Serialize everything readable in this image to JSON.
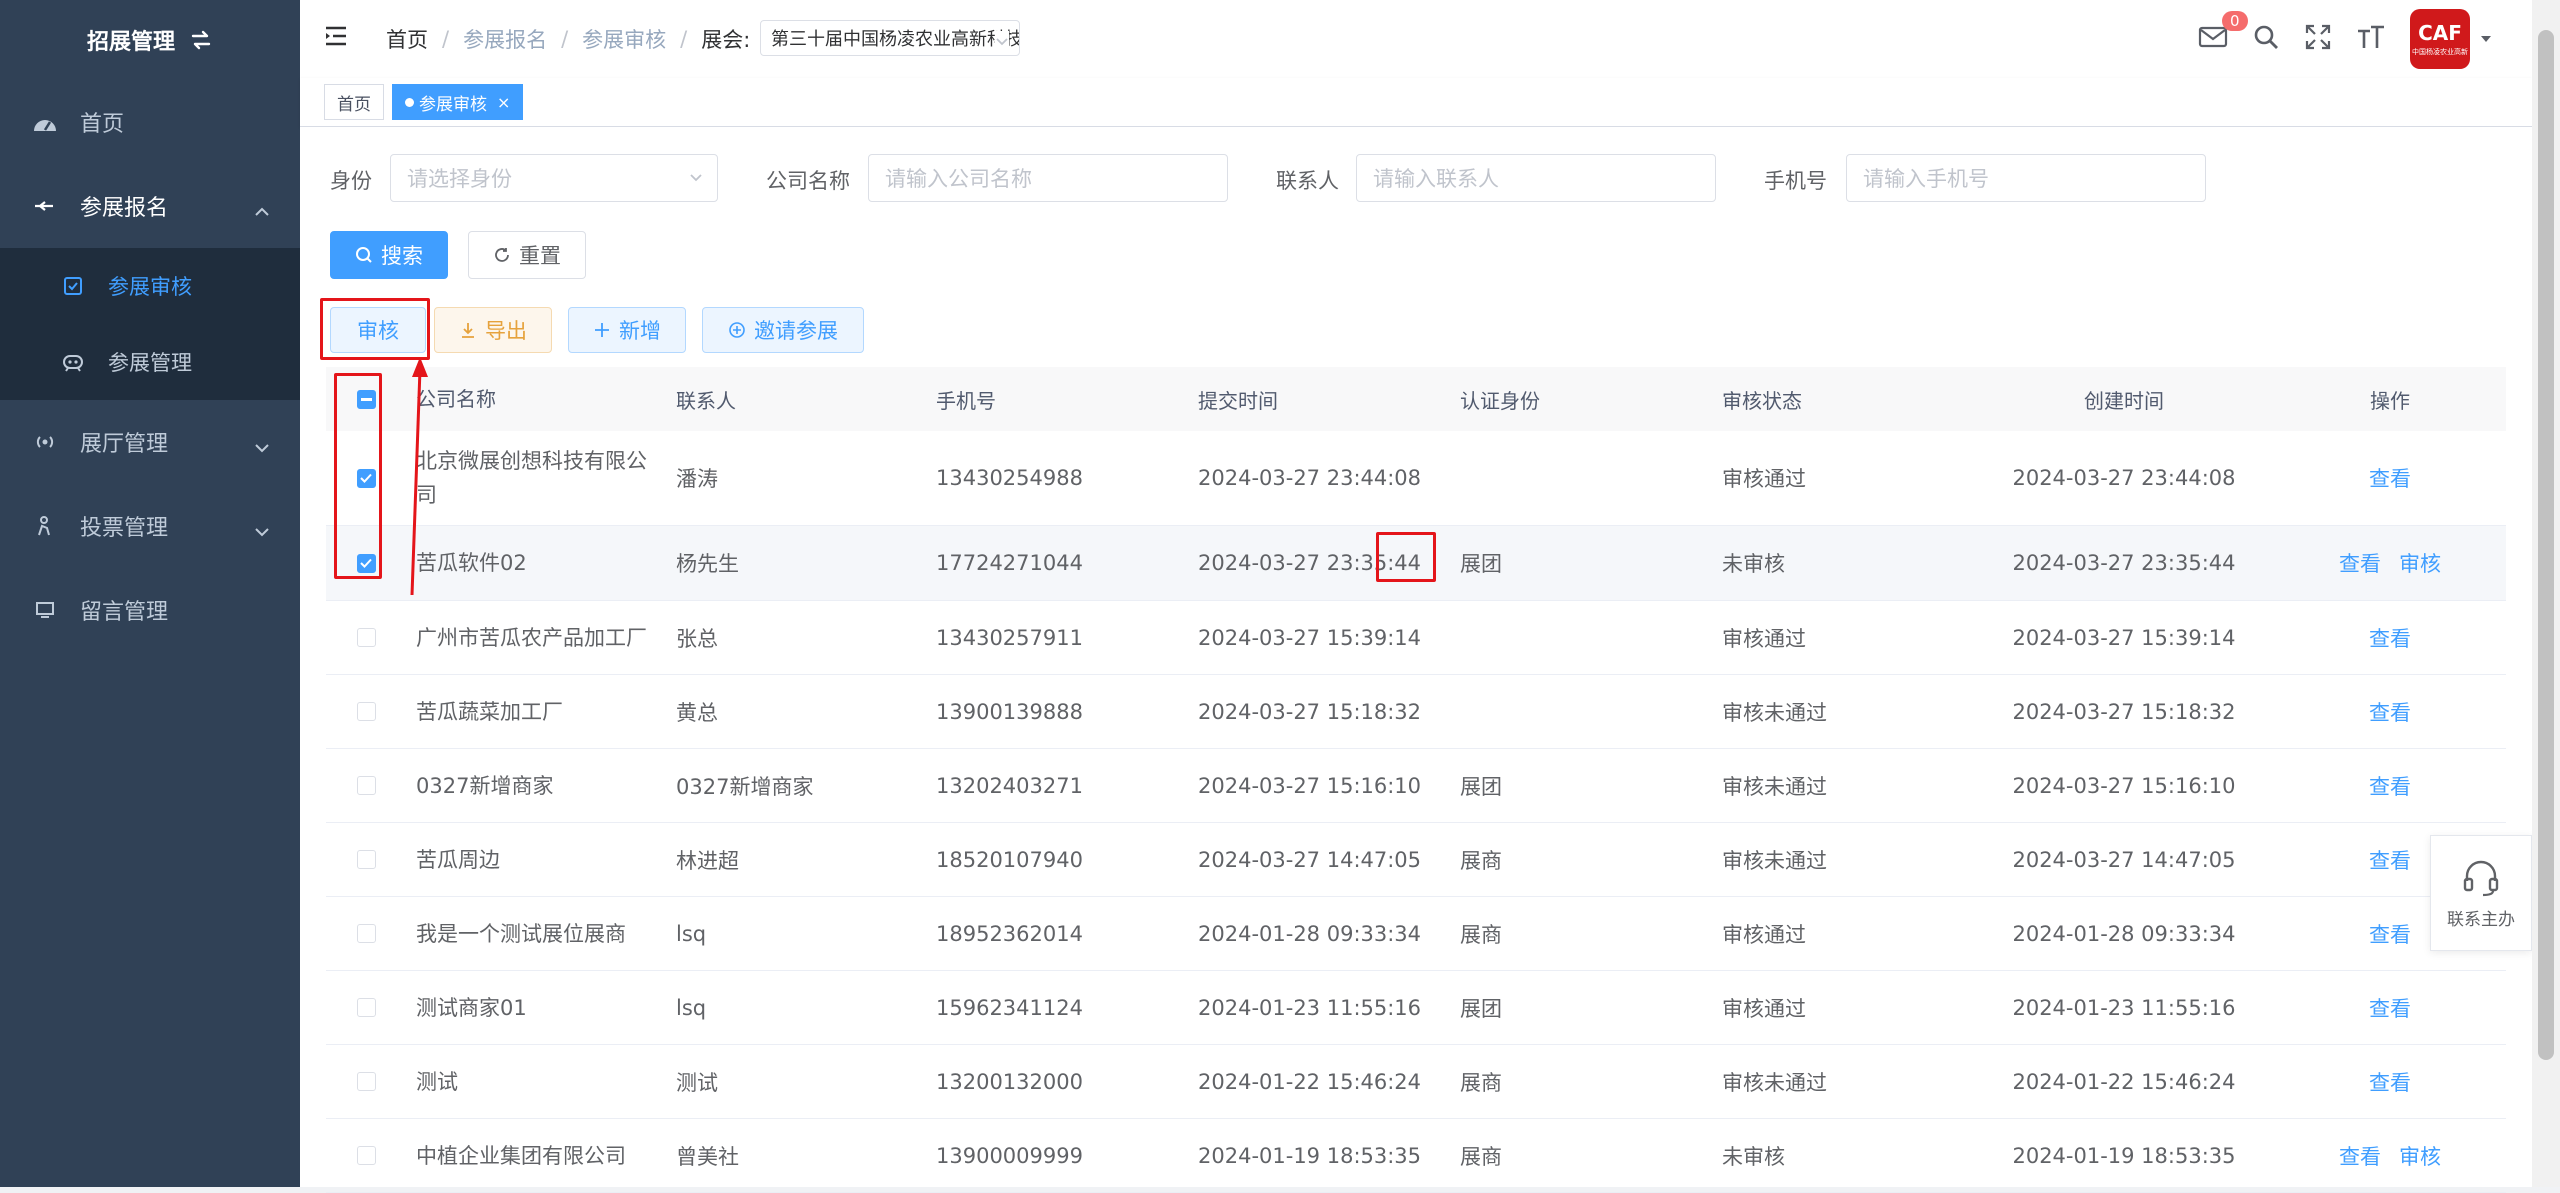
{
  "sidebar": {
    "title": "招展管理",
    "items": [
      {
        "label": "首页",
        "icon": "dashboard-icon"
      },
      {
        "label": "参展报名",
        "icon": "arrow-icon"
      },
      {
        "label": "展厅管理",
        "icon": "broadcast-icon"
      },
      {
        "label": "投票管理",
        "icon": "vote-icon"
      },
      {
        "label": "留言管理",
        "icon": "monitor-icon"
      }
    ],
    "sub_items": [
      {
        "label": "参展审核",
        "icon": "checkbox-icon"
      },
      {
        "label": "参展管理",
        "icon": "robot-icon"
      }
    ]
  },
  "header": {
    "breadcrumb": [
      "首页",
      "参展报名",
      "参展审核"
    ],
    "expo_label": "展会:",
    "expo_value": "第三十届中国杨凌农业高新科技成果博览会",
    "message_count": "0",
    "avatar_text": "CAF",
    "avatar_subtext": "中国杨凌农业高新"
  },
  "tags": {
    "home": "首页",
    "active": "参展审核"
  },
  "search": {
    "identity_label": "身份",
    "identity_placeholder": "请选择身份",
    "company_label": "公司名称",
    "company_placeholder": "请输入公司名称",
    "contact_label": "联系人",
    "contact_placeholder": "请输入联系人",
    "phone_label": "手机号",
    "phone_placeholder": "请输入手机号",
    "search_btn": "搜索",
    "reset_btn": "重置"
  },
  "toolbar": {
    "audit": "审核",
    "export": "导出",
    "add": "新增",
    "invite": "邀请参展"
  },
  "table": {
    "columns": [
      "公司名称",
      "联系人",
      "手机号",
      "提交时间",
      "认证身份",
      "审核状态",
      "创建时间",
      "操作"
    ],
    "view_label": "查看",
    "audit_label": "审核",
    "rows": [
      {
        "company": "北京微展创想科技有限公司",
        "contact": "潘涛",
        "phone": "13430254988",
        "submit": "2024-03-27 23:44:08",
        "identity": "",
        "status": "审核通过",
        "created": "2024-03-27 23:44:08",
        "checked": true,
        "can_audit": false
      },
      {
        "company": "苦瓜软件02",
        "contact": "杨先生",
        "phone": "17724271044",
        "submit": "2024-03-27 23:35:44",
        "identity": "展团",
        "status": "未审核",
        "created": "2024-03-27 23:35:44",
        "checked": true,
        "can_audit": true
      },
      {
        "company": "广州市苦瓜农产品加工厂",
        "contact": "张总",
        "phone": "13430257911",
        "submit": "2024-03-27 15:39:14",
        "identity": "",
        "status": "审核通过",
        "created": "2024-03-27 15:39:14",
        "checked": false,
        "can_audit": false
      },
      {
        "company": "苦瓜蔬菜加工厂",
        "contact": "黄总",
        "phone": "13900139888",
        "submit": "2024-03-27 15:18:32",
        "identity": "",
        "status": "审核未通过",
        "created": "2024-03-27 15:18:32",
        "checked": false,
        "can_audit": false
      },
      {
        "company": "0327新增商家",
        "contact": "0327新增商家",
        "phone": "13202403271",
        "submit": "2024-03-27 15:16:10",
        "identity": "展团",
        "status": "审核未通过",
        "created": "2024-03-27 15:16:10",
        "checked": false,
        "can_audit": false
      },
      {
        "company": "苦瓜周边",
        "contact": "林进超",
        "phone": "18520107940",
        "submit": "2024-03-27 14:47:05",
        "identity": "展商",
        "status": "审核未通过",
        "created": "2024-03-27 14:47:05",
        "checked": false,
        "can_audit": false
      },
      {
        "company": "我是一个测试展位展商",
        "contact": "lsq",
        "phone": "18952362014",
        "submit": "2024-01-28 09:33:34",
        "identity": "展商",
        "status": "审核通过",
        "created": "2024-01-28 09:33:34",
        "checked": false,
        "can_audit": false
      },
      {
        "company": "测试商家01",
        "contact": "lsq",
        "phone": "15962341124",
        "submit": "2024-01-23 11:55:16",
        "identity": "展团",
        "status": "审核通过",
        "created": "2024-01-23 11:55:16",
        "checked": false,
        "can_audit": false
      },
      {
        "company": "测试",
        "contact": "测试",
        "phone": "13200132000",
        "submit": "2024-01-22 15:46:24",
        "identity": "展商",
        "status": "审核未通过",
        "created": "2024-01-22 15:46:24",
        "checked": false,
        "can_audit": false
      },
      {
        "company": "中植企业集团有限公司",
        "contact": "曾美社",
        "phone": "13900009999",
        "submit": "2024-01-19 18:53:35",
        "identity": "展商",
        "status": "未审核",
        "created": "2024-01-19 18:53:35",
        "checked": false,
        "can_audit": true
      }
    ]
  },
  "float_help": {
    "label": "联系主办",
    "icon": "headset-icon"
  },
  "colors": {
    "primary": "#409eff",
    "sidebar_bg": "#304156",
    "annotation_red": "#e4151a"
  }
}
